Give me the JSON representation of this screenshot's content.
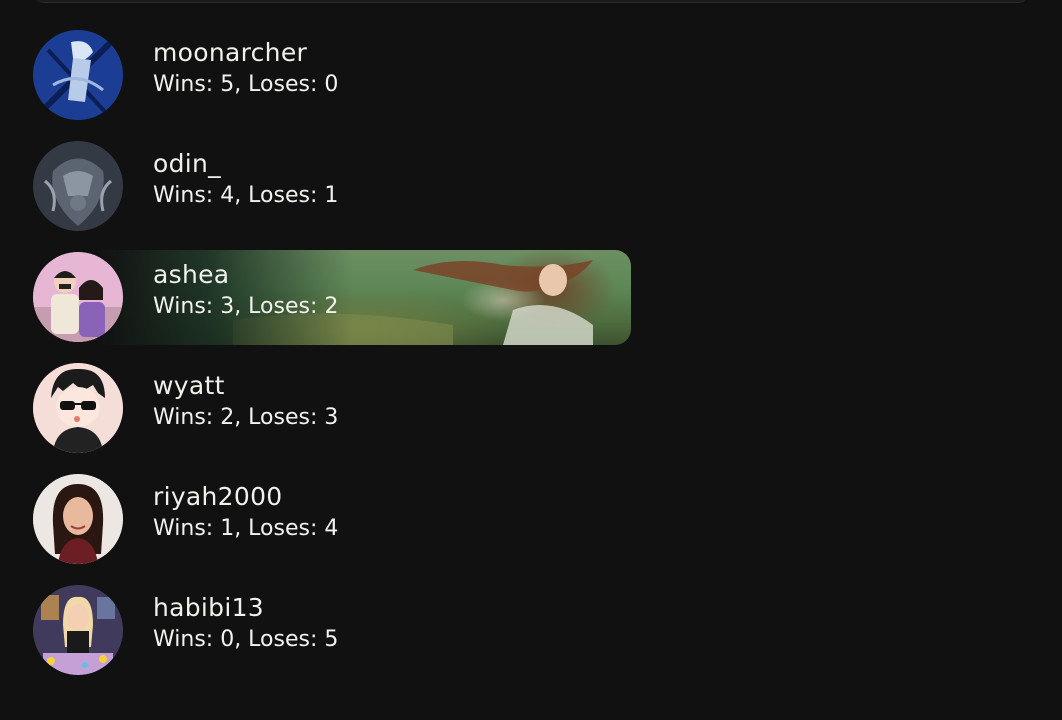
{
  "players": [
    {
      "username": "moonarcher",
      "record": "Wins: 5, Loses: 0",
      "avatar_icon": "moon-archer-avatar-icon"
    },
    {
      "username": "odin_",
      "record": "Wins: 4, Loses: 1",
      "avatar_icon": "armored-knight-avatar-icon"
    },
    {
      "username": "ashea",
      "record": "Wins: 3, Loses: 2",
      "avatar_icon": "couple-avatar-icon",
      "highlighted": true
    },
    {
      "username": "wyatt",
      "record": "Wins: 2, Loses: 3",
      "avatar_icon": "sunglasses-boy-avatar-icon"
    },
    {
      "username": "riyah2000",
      "record": "Wins: 1, Loses: 4",
      "avatar_icon": "woman-portrait-avatar-icon"
    },
    {
      "username": "habibi13",
      "record": "Wins: 0, Loses: 5",
      "avatar_icon": "girl-room-avatar-icon"
    }
  ],
  "colors": {
    "background": "#111111",
    "text": "#eef0ea",
    "highlight_banner": "#5e8756"
  }
}
